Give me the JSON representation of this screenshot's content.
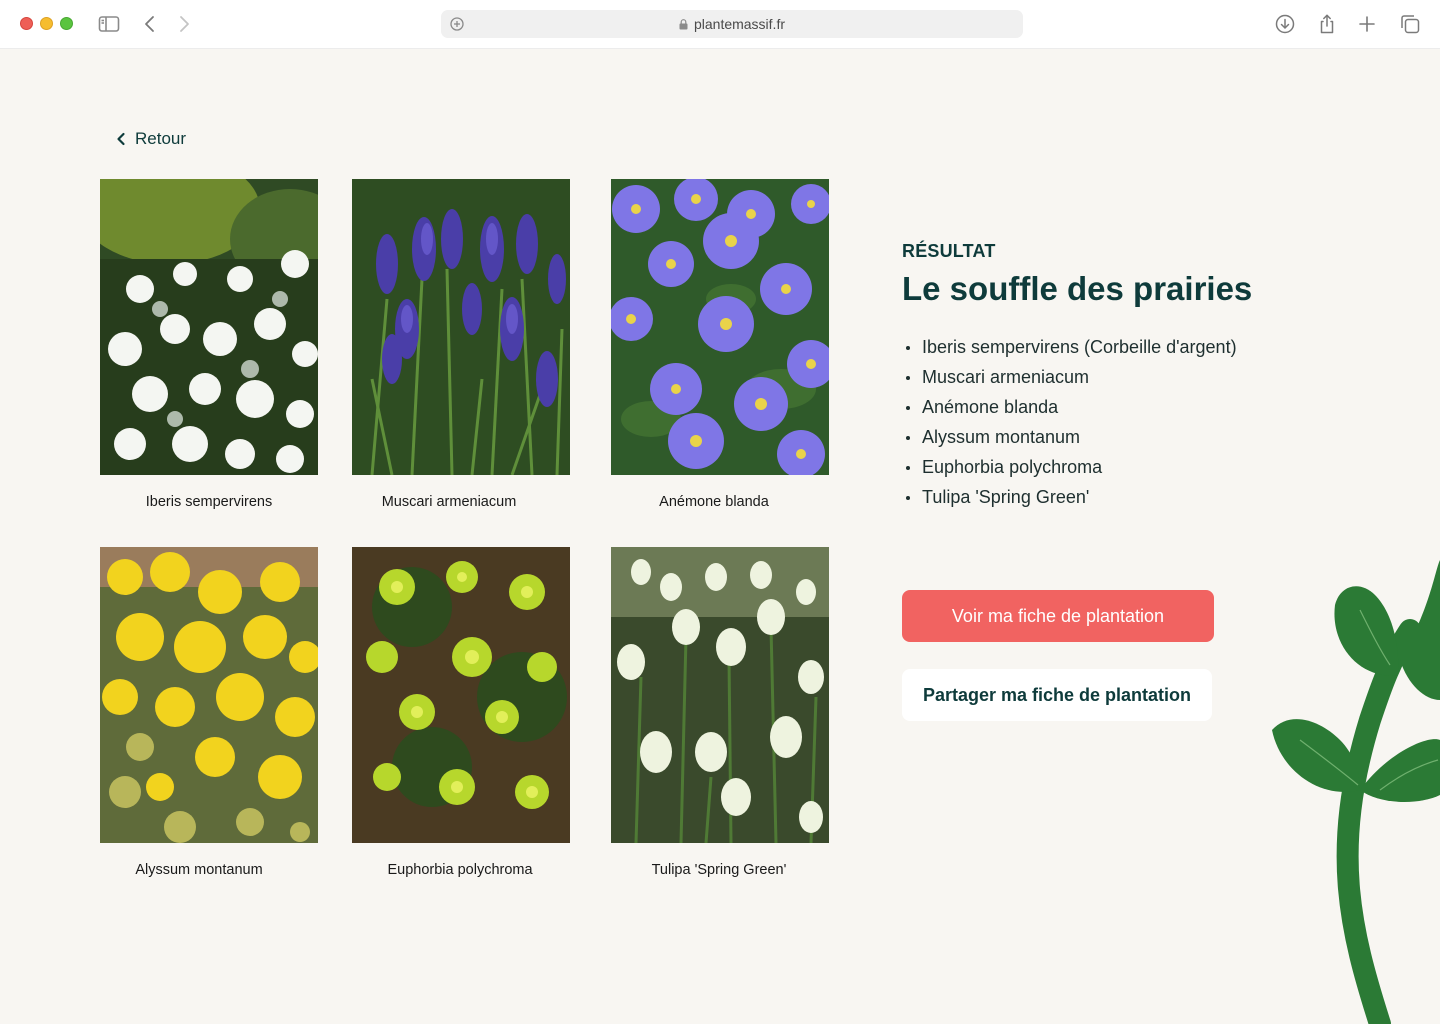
{
  "browser": {
    "url": "plantemassif.fr"
  },
  "page": {
    "back_label": "Retour",
    "result_kicker": "RÉSULTAT",
    "result_title": "Le souffle des prairies",
    "plant_list": [
      "Iberis sempervirens (Corbeille d'argent)",
      "Muscari armeniacum",
      "Anémone blanda",
      "Alyssum montanum",
      "Euphorbia polychroma",
      "Tulipa 'Spring Green'"
    ],
    "primary_button": "Voir ma fiche de plantation",
    "secondary_button": "Partager ma fiche de plantation"
  },
  "gallery": [
    {
      "caption": "Iberis sempervirens",
      "image": "white-flower-photo"
    },
    {
      "caption": "Muscari armeniacum",
      "image": "blue-grape-hyacinth-photo"
    },
    {
      "caption": "Anémone blanda",
      "image": "purple-daisy-photo"
    },
    {
      "caption": "Alyssum montanum",
      "image": "yellow-flower-photo"
    },
    {
      "caption": "Euphorbia polychroma",
      "image": "lime-green-euphorbia-photo"
    },
    {
      "caption": "Tulipa 'Spring Green'",
      "image": "white-tulip-photo"
    }
  ],
  "colors": {
    "accent": "#f16361",
    "brand_dark": "#0e3b3b",
    "background": "#f8f6f2",
    "leaf_green": "#2b7a35"
  }
}
